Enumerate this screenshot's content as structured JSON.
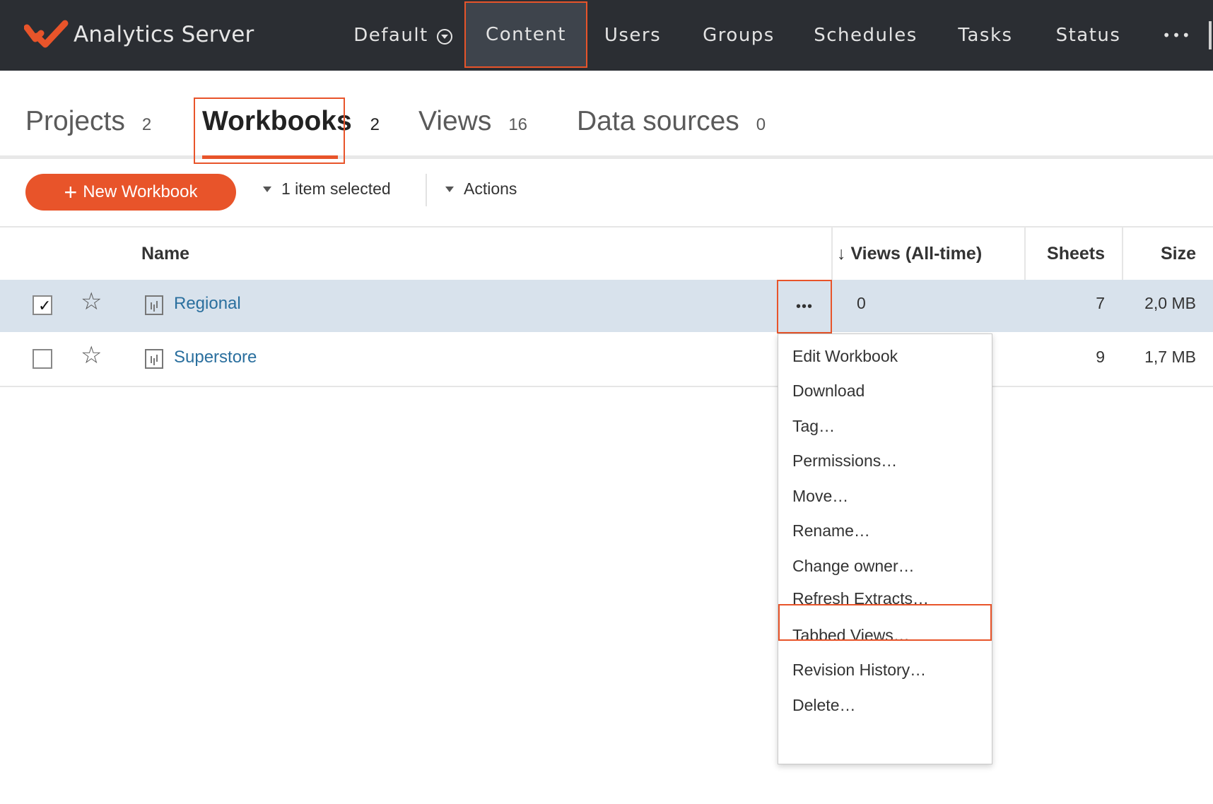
{
  "app": {
    "brand_name": "Analytics Server",
    "accent_color": "#e8542a",
    "nav_bg_color": "#2b2e33"
  },
  "nav": {
    "site": "Default",
    "items": [
      "Content",
      "Users",
      "Groups",
      "Schedules",
      "Tasks",
      "Status"
    ],
    "more": "•••",
    "active": "Content"
  },
  "tabs": [
    {
      "label": "Projects",
      "count": "2"
    },
    {
      "label": "Workbooks",
      "count": "2",
      "active": true
    },
    {
      "label": "Views",
      "count": "16"
    },
    {
      "label": "Data sources",
      "count": "0"
    }
  ],
  "toolbar": {
    "new_label": "New Workbook",
    "selection_label": "1 item selected",
    "actions_label": "Actions"
  },
  "table": {
    "columns": {
      "name": "Name",
      "views": "↓ Views (All-time)",
      "sheets": "Sheets",
      "size": "Size"
    },
    "rows": [
      {
        "name": "Regional",
        "views": "0",
        "sheets": "7",
        "size": "2,0 MB",
        "checked": true,
        "selected": true
      },
      {
        "name": "Superstore",
        "views": "",
        "sheets": "9",
        "size": "1,7 MB",
        "checked": false
      }
    ],
    "row_more": "•••"
  },
  "menu": {
    "items": [
      "Edit Workbook",
      "Download",
      "Tag…",
      "Permissions…",
      "Move…",
      "Rename…",
      "Change owner…",
      "Refresh Extracts…",
      "Tabbed Views…",
      "Revision History…",
      "Delete…"
    ],
    "highlighted": "Refresh Extracts…"
  }
}
